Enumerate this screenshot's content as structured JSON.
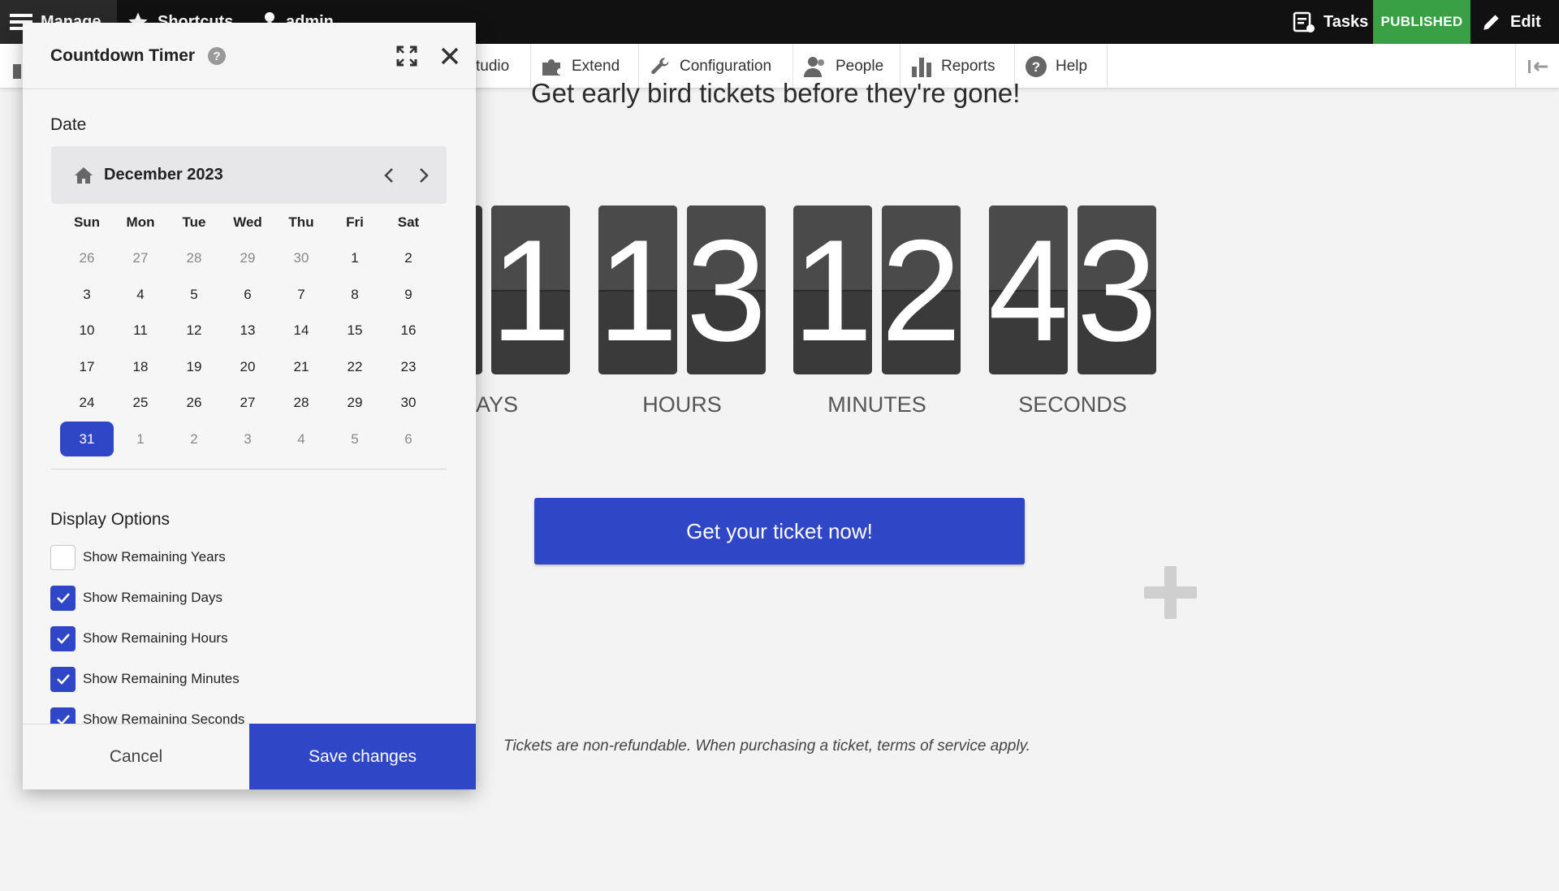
{
  "topbar": {
    "manage": "Manage",
    "shortcuts": "Shortcuts",
    "user": "admin",
    "tasks": "Tasks",
    "status": "PUBLISHED",
    "edit": "Edit",
    "status_color": "#3aa045"
  },
  "toolbar": {
    "items": [
      {
        "label": "tudio",
        "icon": "studio-icon"
      },
      {
        "label": "Extend",
        "icon": "puzzle-icon"
      },
      {
        "label": "Configuration",
        "icon": "wrench-icon"
      },
      {
        "label": "People",
        "icon": "people-icon"
      },
      {
        "label": "Reports",
        "icon": "bar-chart-icon"
      },
      {
        "label": "Help",
        "icon": "help-icon"
      }
    ]
  },
  "page": {
    "headline": "Get early bird tickets before they're gone!",
    "countdown": {
      "days_digit_visible": "1",
      "hours": [
        "1",
        "3"
      ],
      "minutes": [
        "1",
        "2"
      ],
      "seconds": [
        "4",
        "3"
      ],
      "labels": {
        "days": "AYS",
        "hours": "HOURS",
        "minutes": "MINUTES",
        "seconds": "SECONDS"
      }
    },
    "cta": "Get your ticket now!",
    "disclaimer": "Tickets are non-refundable. When purchasing a ticket, terms of service apply.",
    "accent_color": "#2f46c7"
  },
  "dialog": {
    "title": "Countdown Timer",
    "help": "?",
    "date_label": "Date",
    "calendar": {
      "month": "December 2023",
      "weekdays": [
        "Sun",
        "Mon",
        "Tue",
        "Wed",
        "Thu",
        "Fri",
        "Sat"
      ],
      "weeks": [
        [
          "26",
          "27",
          "28",
          "29",
          "30",
          "1",
          "2"
        ],
        [
          "3",
          "4",
          "5",
          "6",
          "7",
          "8",
          "9"
        ],
        [
          "10",
          "11",
          "12",
          "13",
          "14",
          "15",
          "16"
        ],
        [
          "17",
          "18",
          "19",
          "20",
          "21",
          "22",
          "23"
        ],
        [
          "24",
          "25",
          "26",
          "27",
          "28",
          "29",
          "30"
        ],
        [
          "31",
          "1",
          "2",
          "3",
          "4",
          "5",
          "6"
        ]
      ],
      "selected": "31"
    },
    "display_options_label": "Display Options",
    "options": [
      {
        "label": "Show Remaining Years",
        "checked": false
      },
      {
        "label": "Show Remaining Days",
        "checked": true
      },
      {
        "label": "Show Remaining Hours",
        "checked": true
      },
      {
        "label": "Show Remaining Minutes",
        "checked": true
      },
      {
        "label": "Show Remaining Seconds",
        "checked": true
      }
    ],
    "cancel": "Cancel",
    "save": "Save changes"
  }
}
